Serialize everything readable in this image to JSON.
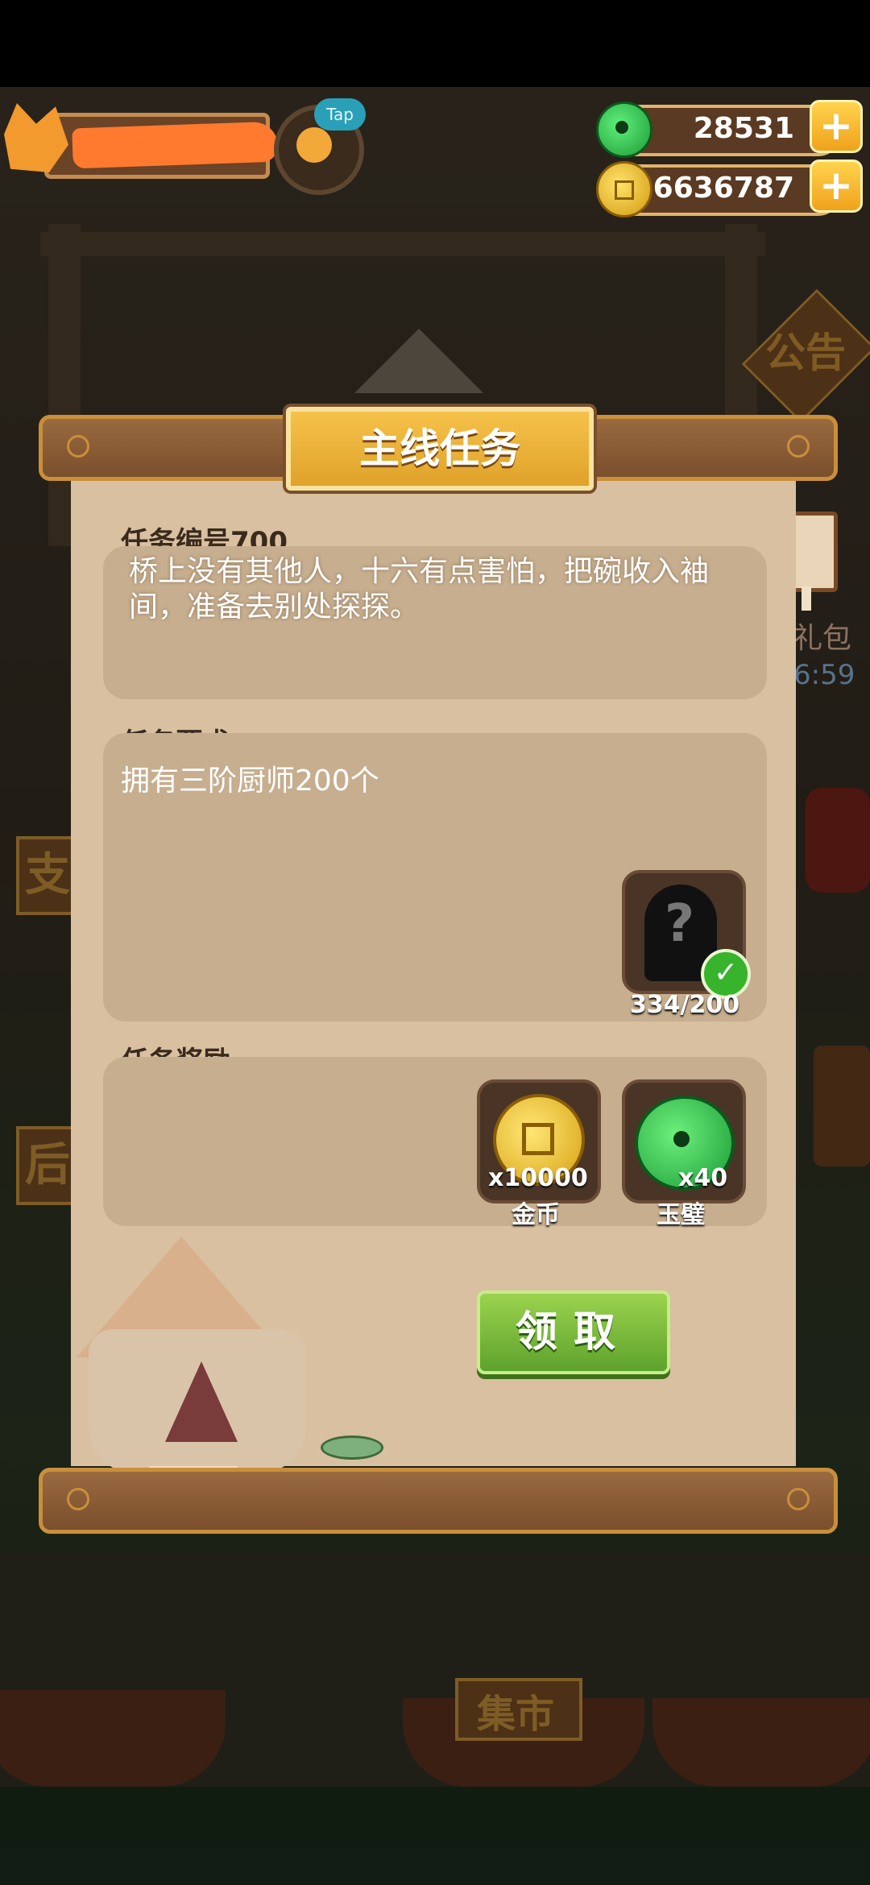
{
  "hud": {
    "tap_label": "Tap",
    "jade_amount": "28531",
    "coin_amount": "36636787"
  },
  "background": {
    "notice_label": "公告",
    "market_label": "集市",
    "gift_timer": "6:59",
    "gift_label": "礼包"
  },
  "dialog": {
    "title": "主线任务",
    "task_number_label": "任务编号700",
    "story_text": "桥上没有其他人，十六有点害怕，把碗收入袖间，准备去别处探探。",
    "requirement_label": "任务要求",
    "requirement_text": "拥有三阶厨师200个",
    "requirement_progress": "334/200",
    "requirement_done": true,
    "reward_label": "任务奖励",
    "rewards": [
      {
        "qty": "x10000",
        "name": "金币",
        "icon": "gold-coin-icon"
      },
      {
        "qty": "x40",
        "name": "玉璧",
        "icon": "jade-disc-icon"
      }
    ],
    "claim_label": "领取"
  },
  "colors": {
    "paper": "#d8c0a1",
    "box": "#c6ae8f",
    "title_gold": "#f6c24a",
    "claim_green": "#6fb236",
    "wood": "#8a5a32"
  }
}
